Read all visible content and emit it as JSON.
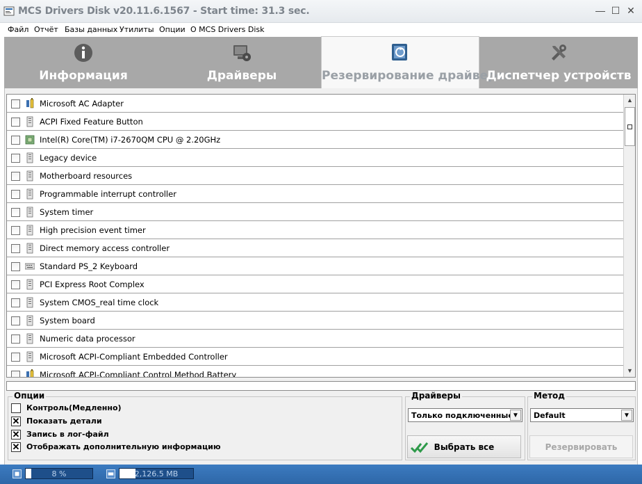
{
  "window": {
    "title": "MCS Drivers Disk v20.11.6.1567 - Start time: 31.3 sec.",
    "controls": [
      "—",
      "☐",
      "✕"
    ]
  },
  "menu": [
    "Файл",
    "Отчёт",
    "Базы данных",
    "Утилиты",
    "Опции",
    "О MCS Drivers Disk"
  ],
  "tabs": [
    {
      "label": "Информация",
      "icon": "info-icon",
      "active": false
    },
    {
      "label": "Драйверы",
      "icon": "drivers-icon",
      "active": false
    },
    {
      "label": "Резервирование драйверов",
      "icon": "backup-icon",
      "active": true
    },
    {
      "label": "Диспетчер устройств",
      "icon": "tools-icon",
      "active": false
    }
  ],
  "devices": [
    {
      "name": "Microsoft AC Adapter",
      "icon": "battery-icon",
      "checked": false
    },
    {
      "name": "ACPI Fixed Feature Button",
      "icon": "system-device-icon",
      "checked": false
    },
    {
      "name": "Intel(R) Core(TM) i7-2670QM CPU @ 2.20GHz",
      "icon": "processor-icon",
      "checked": false
    },
    {
      "name": "Legacy device",
      "icon": "system-device-icon",
      "checked": false
    },
    {
      "name": "Motherboard resources",
      "icon": "system-device-icon",
      "checked": false
    },
    {
      "name": "Programmable interrupt controller",
      "icon": "system-device-icon",
      "checked": false
    },
    {
      "name": "System timer",
      "icon": "system-device-icon",
      "checked": false
    },
    {
      "name": "High precision event timer",
      "icon": "system-device-icon",
      "checked": false
    },
    {
      "name": "Direct memory access controller",
      "icon": "system-device-icon",
      "checked": false
    },
    {
      "name": "Standard PS_2 Keyboard",
      "icon": "keyboard-icon",
      "checked": false
    },
    {
      "name": "PCI Express Root Complex",
      "icon": "system-device-icon",
      "checked": false
    },
    {
      "name": "System CMOS_real time clock",
      "icon": "system-device-icon",
      "checked": false
    },
    {
      "name": "System board",
      "icon": "system-device-icon",
      "checked": false
    },
    {
      "name": "Numeric data processor",
      "icon": "system-device-icon",
      "checked": false
    },
    {
      "name": "Microsoft ACPI-Compliant Embedded Controller",
      "icon": "system-device-icon",
      "checked": false
    },
    {
      "name": "Microsoft ACPI-Compliant Control Method Battery",
      "icon": "battery-icon",
      "checked": false
    }
  ],
  "options": {
    "label": "Опции",
    "items": [
      {
        "label": "Контроль(Медленно)",
        "checked": false
      },
      {
        "label": "Показать детали",
        "checked": true
      },
      {
        "label": "Запись в лог-файл",
        "checked": true
      },
      {
        "label": "Отображать дополнительную информацию",
        "checked": true
      }
    ]
  },
  "drivers_group": {
    "label": "Драйверы",
    "filter_value": "Только подключенные",
    "select_all_label": "Выбрать все"
  },
  "method_group": {
    "label": "Метод",
    "method_value": "Default",
    "backup_label": "Резервировать"
  },
  "status": {
    "cpu_text": "8 %",
    "cpu_fraction": 0.08,
    "memory_text": "2,126.5 MB",
    "memory_fraction": 0.22
  },
  "colors": {
    "tab_bar": "#a8a8a8",
    "status_bar": "#2e67a8",
    "select_all_check": "#2e9a4a"
  }
}
